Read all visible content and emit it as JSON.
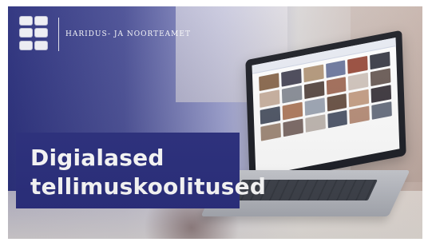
{
  "header": {
    "organization_name": "Haridus- ja Noorteamet",
    "logo_icon": "estonia-coat-of-arms-icon"
  },
  "hero": {
    "title_line1": "Digialased",
    "title_line2": "tellimuskoolitused"
  },
  "colors": {
    "primary": "#2b2f7f"
  }
}
